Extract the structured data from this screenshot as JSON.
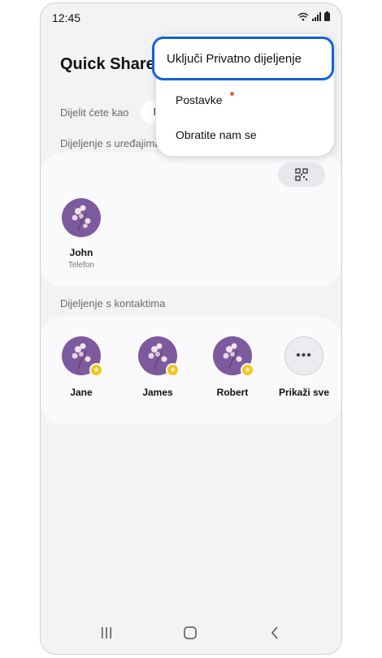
{
  "status_bar": {
    "time": "12:45"
  },
  "app": {
    "title": "Quick Share"
  },
  "share_as": {
    "label": "Dijelit ćete kao",
    "value": "I"
  },
  "devices_section": {
    "label": "Dijeljenje s uređajima",
    "devices": [
      {
        "name": "John",
        "type": "Telefon"
      }
    ]
  },
  "contacts_section": {
    "label": "Dijeljenje s kontaktima",
    "contacts": [
      {
        "name": "Jane"
      },
      {
        "name": "James"
      },
      {
        "name": "Robert"
      }
    ],
    "show_all_label": "Prikaži sve"
  },
  "menu": {
    "items": [
      {
        "label": "Uključi Privatno dijeljenje",
        "highlighted": true
      },
      {
        "label": "Postavke",
        "has_badge": true
      },
      {
        "label": "Obratite nam se"
      }
    ]
  },
  "colors": {
    "highlight_border": "#1162d8",
    "badge": "#e8603c",
    "avatar_bg": "#7d5a9e",
    "favorite_star": "#f5c518"
  }
}
